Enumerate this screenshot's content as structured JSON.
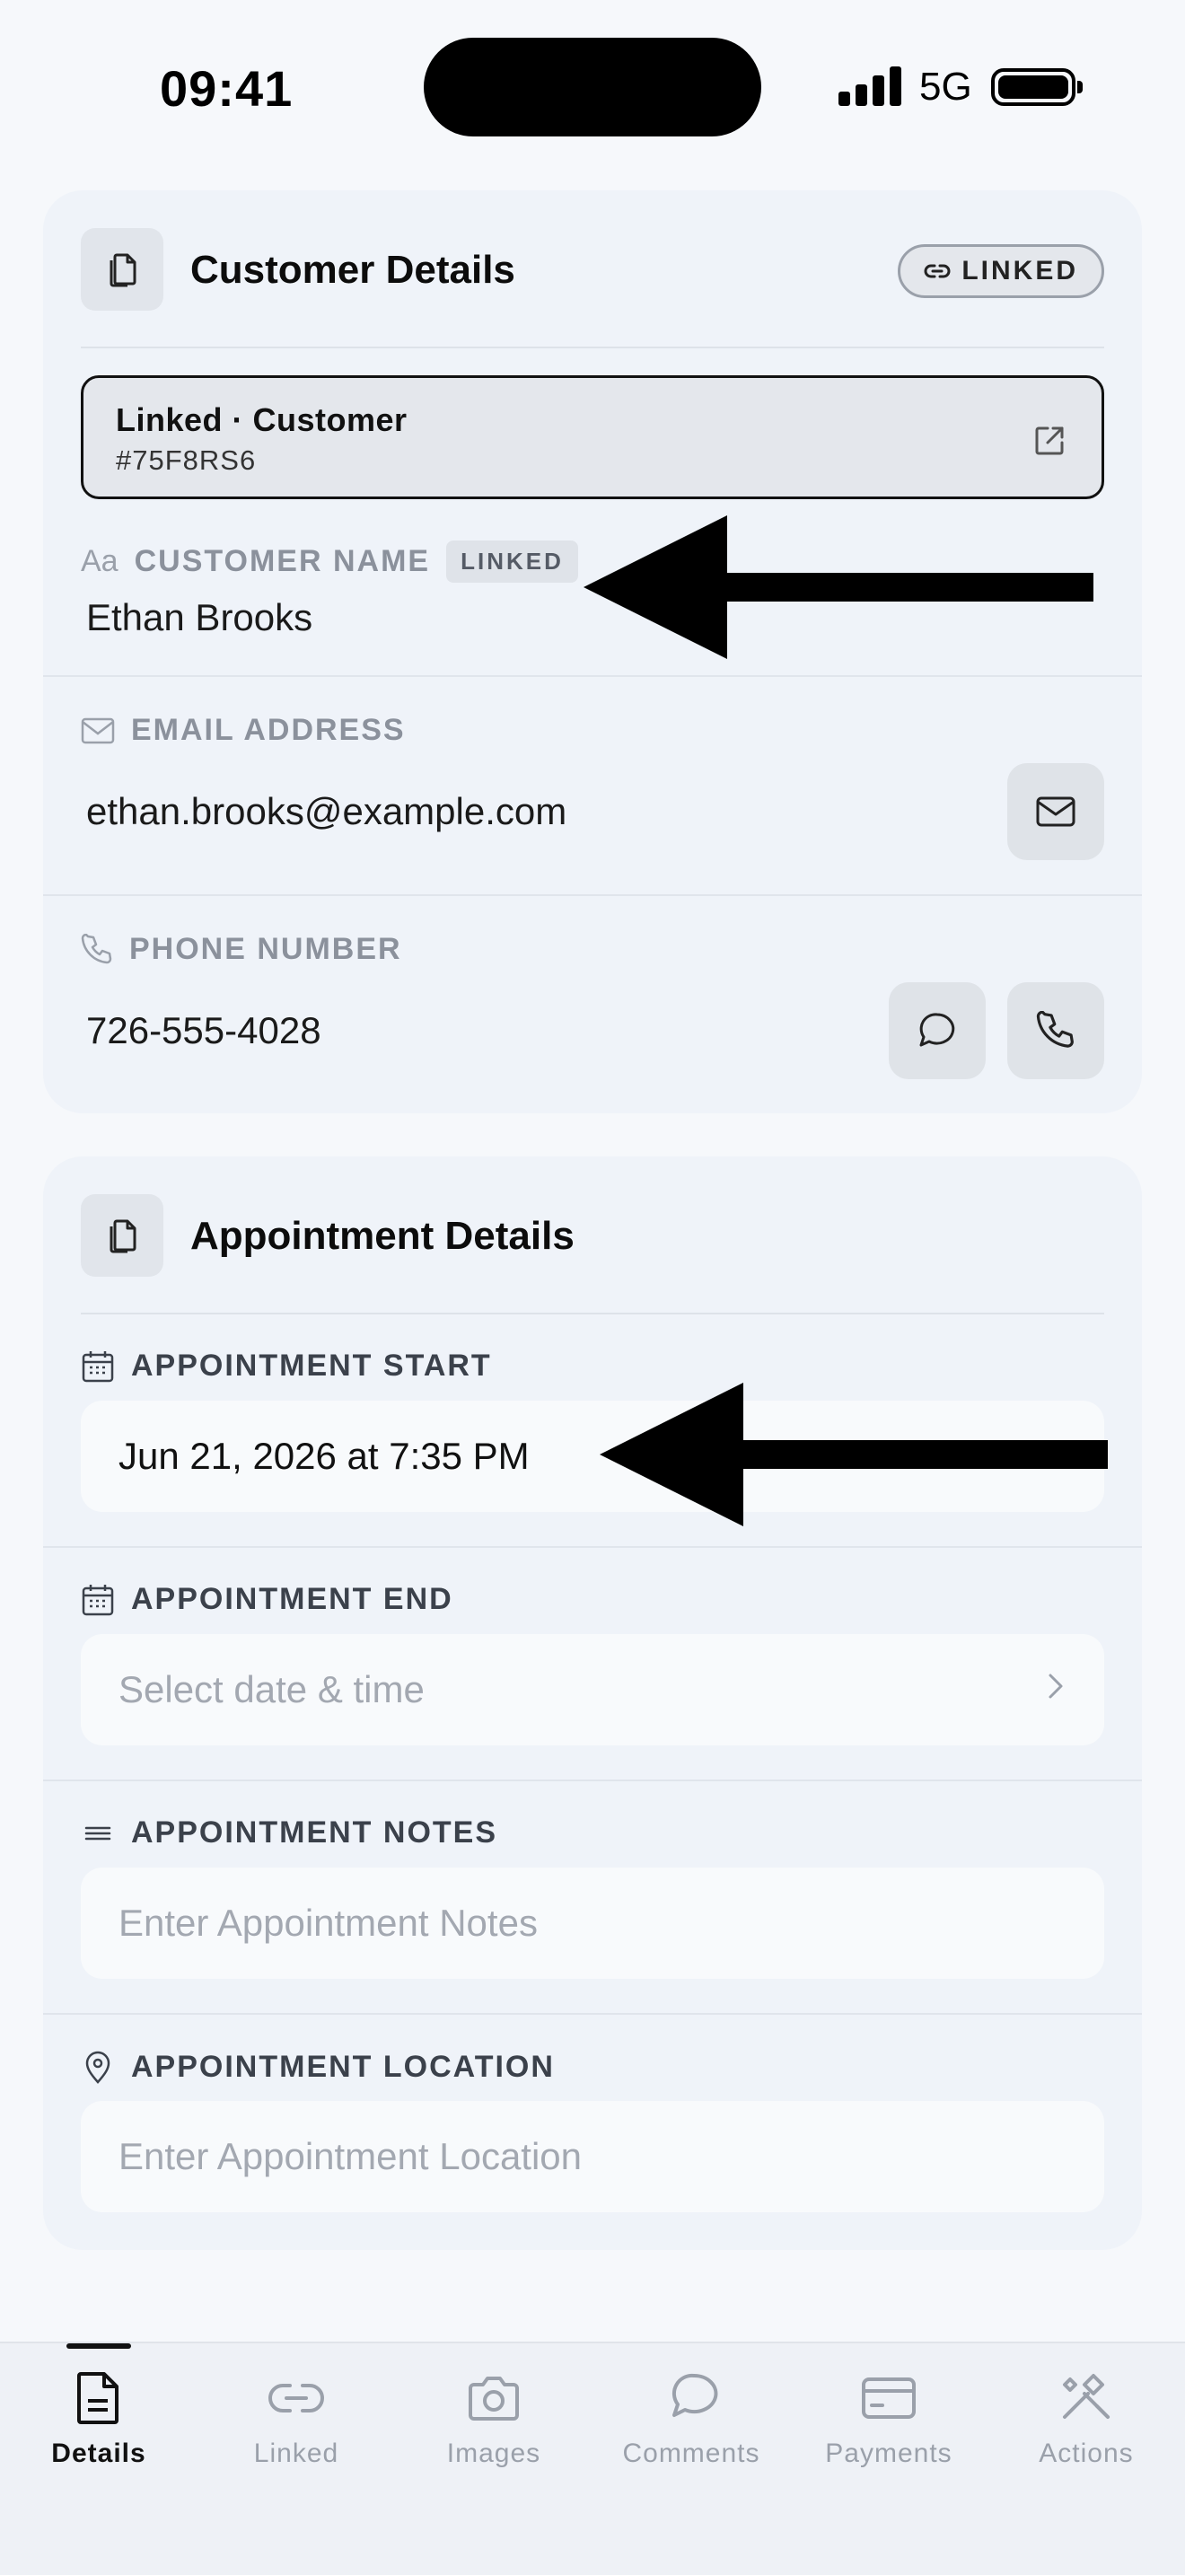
{
  "status_bar": {
    "time": "09:41",
    "network": "5G"
  },
  "customer_card": {
    "title": "Customer Details",
    "linked_pill": "LINKED",
    "linked_record": {
      "title": "Linked · Customer",
      "id": "#75F8RS6"
    },
    "name_field": {
      "prefix": "Aa",
      "label": "CUSTOMER NAME",
      "badge": "LINKED",
      "value": "Ethan Brooks"
    },
    "email_field": {
      "label": "EMAIL ADDRESS",
      "value": "ethan.brooks@example.com"
    },
    "phone_field": {
      "label": "PHONE NUMBER",
      "value": "726-555-4028"
    }
  },
  "appointment_card": {
    "title": "Appointment Details",
    "start": {
      "label": "APPOINTMENT START",
      "value": "Jun 21, 2026 at 7:35 PM"
    },
    "end": {
      "label": "APPOINTMENT END",
      "placeholder": "Select date & time"
    },
    "notes": {
      "label": "APPOINTMENT NOTES",
      "placeholder": "Enter Appointment Notes"
    },
    "location": {
      "label": "APPOINTMENT LOCATION",
      "placeholder": "Enter Appointment Location"
    }
  },
  "tabs": [
    {
      "label": "Details",
      "icon": "document-icon",
      "active": true
    },
    {
      "label": "Linked",
      "icon": "link-icon",
      "active": false
    },
    {
      "label": "Images",
      "icon": "camera-icon",
      "active": false
    },
    {
      "label": "Comments",
      "icon": "chat-icon",
      "active": false
    },
    {
      "label": "Payments",
      "icon": "card-icon",
      "active": false
    },
    {
      "label": "Actions",
      "icon": "tools-icon",
      "active": false
    }
  ],
  "colors": {
    "background": "#f6f8fb",
    "card": "#eff3f9",
    "label_muted": "#8b919c",
    "label_dark": "#3b414b",
    "placeholder": "#a3a8b1"
  }
}
